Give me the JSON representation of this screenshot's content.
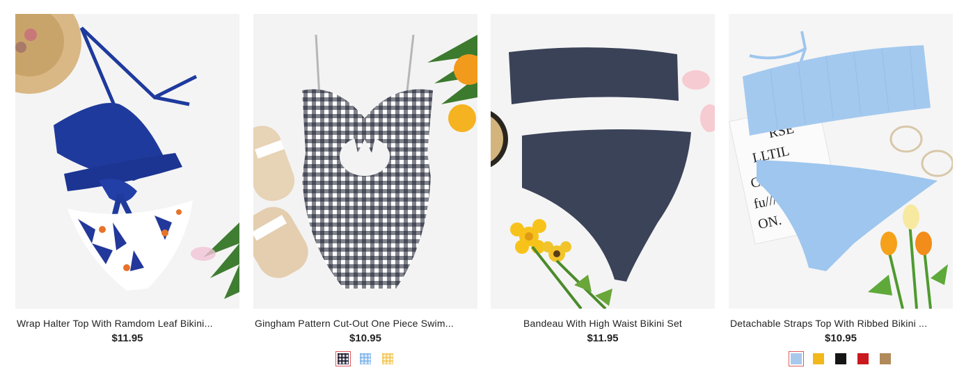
{
  "products": [
    {
      "title": "Wrap Halter Top With Ramdom Leaf Bikini...",
      "price": "$11.95",
      "image_alt": "Wrap Halter Top With Ramdom Leaf Bikini",
      "main_color": "#1e3a9c"
    },
    {
      "title": "Gingham Pattern Cut-Out One Piece Swim...",
      "price": "$10.95",
      "image_alt": "Gingham Pattern Cut-Out One Piece Swimsuit",
      "swatches": [
        {
          "name": "black-white gingham",
          "selected": true
        },
        {
          "name": "blue gingham",
          "selected": false
        },
        {
          "name": "yellow gingham",
          "selected": false
        }
      ]
    },
    {
      "title": "Bandeau With High Waist Bikini Set",
      "price": "$11.95",
      "image_alt": "Bandeau With High Waist Bikini Set",
      "main_color": "#3a4258"
    },
    {
      "title": "Detachable Straps Top With Ribbed Bikini ...",
      "price": "$10.95",
      "image_alt": "Detachable Straps Top With Ribbed Bikini",
      "main_color": "#9ec6ee",
      "swatches": [
        {
          "name": "light blue",
          "color": "#a9c9ec",
          "selected": true
        },
        {
          "name": "yellow",
          "color": "#f2b81b",
          "selected": false
        },
        {
          "name": "black",
          "color": "#151515",
          "selected": false
        },
        {
          "name": "red",
          "color": "#c9191e",
          "selected": false
        },
        {
          "name": "khaki",
          "color": "#b08a5a",
          "selected": false
        }
      ]
    }
  ]
}
